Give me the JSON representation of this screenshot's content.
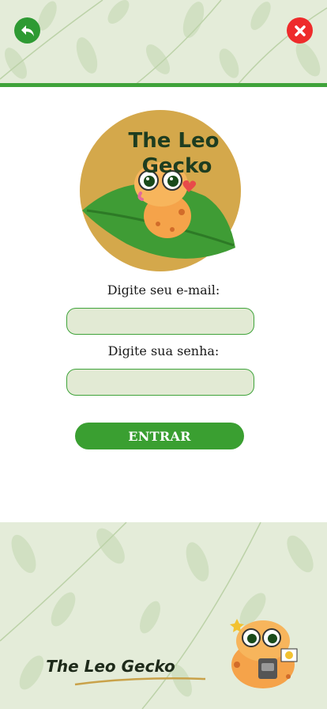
{
  "header": {
    "back_icon": "back-arrow-icon",
    "close_icon": "close-x-icon",
    "accent_color": "#3fa33a",
    "back_color": "#2e9a33",
    "close_color": "#ee2b2b"
  },
  "logo": {
    "title_line1": "The Leo",
    "title_line2": "Gecko"
  },
  "form": {
    "email_label": "Digite seu e-mail:",
    "email_value": "",
    "password_label": "Digite sua senha:",
    "password_value": "",
    "submit_label": "ENTRAR",
    "field_bg_color": "#e2ead4",
    "button_color": "#3a9f31"
  },
  "footer": {
    "brand_text": "The Leo Gecko",
    "background_color": "#e4ecd9"
  }
}
